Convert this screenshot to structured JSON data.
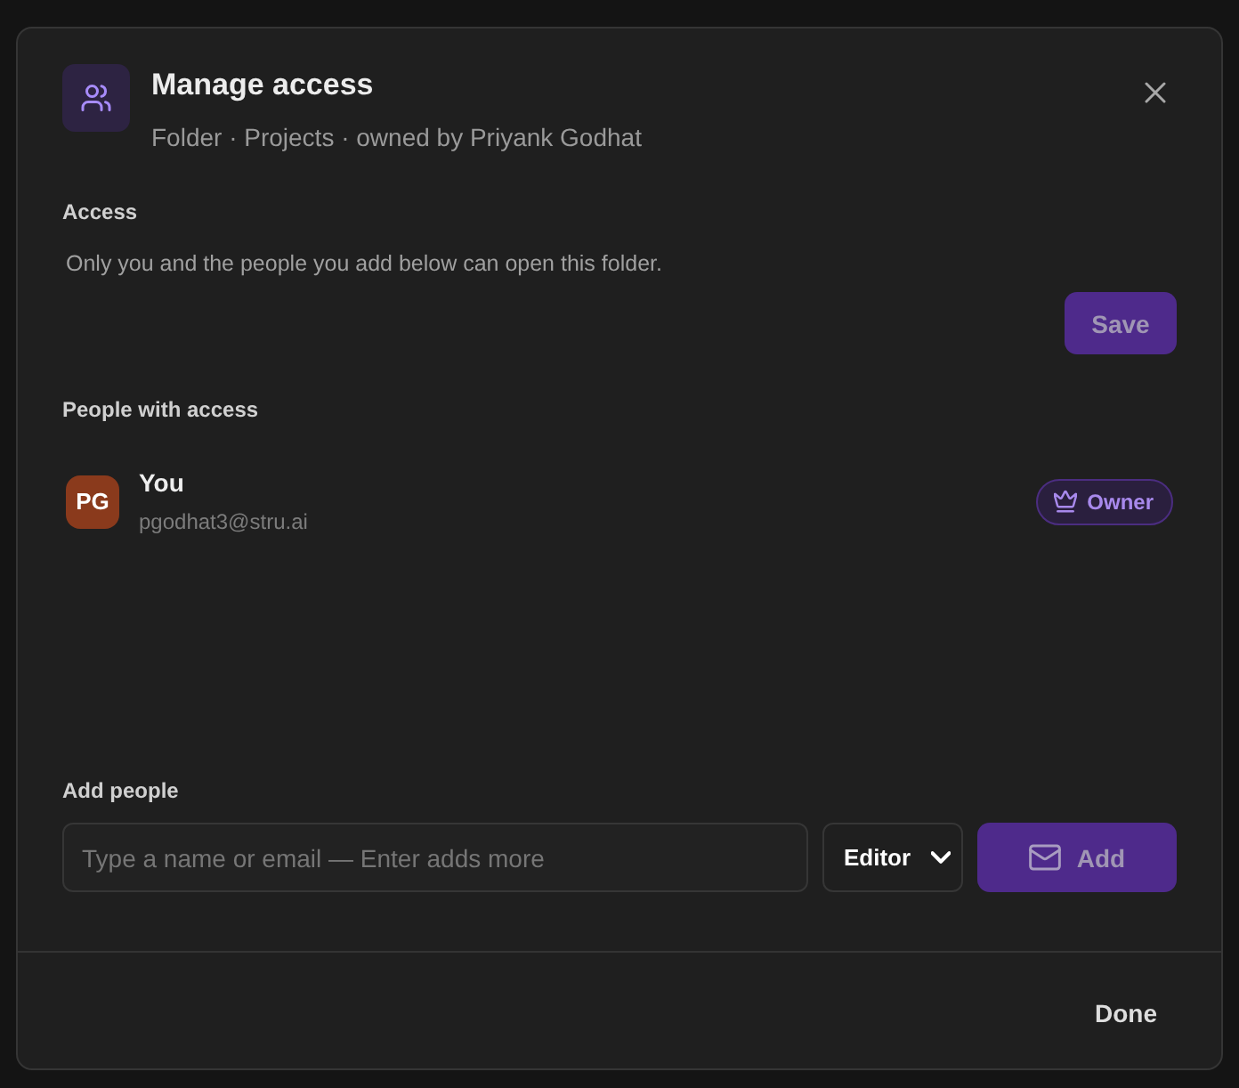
{
  "dialog": {
    "title": "Manage access",
    "subtitle": "Folder · Projects · owned by Priyank Godhat"
  },
  "access": {
    "heading": "Access",
    "description": "Only you and the people you add below can open this folder.",
    "save_button": {
      "label": "Save",
      "disabled": true
    }
  },
  "people": {
    "heading": "People with access",
    "members": [
      {
        "initials": "PG",
        "name": "You",
        "email": "pgodhat3@stru.ai",
        "role": "Owner",
        "color": "#8a3a1c"
      }
    ]
  },
  "add_people": {
    "heading": "Add people",
    "placeholder": "Type a name or email — Enter adds more",
    "role": "Editor",
    "add_button": {
      "label": "Add",
      "disabled": true
    }
  },
  "footer": {
    "done_button": "Done"
  }
}
